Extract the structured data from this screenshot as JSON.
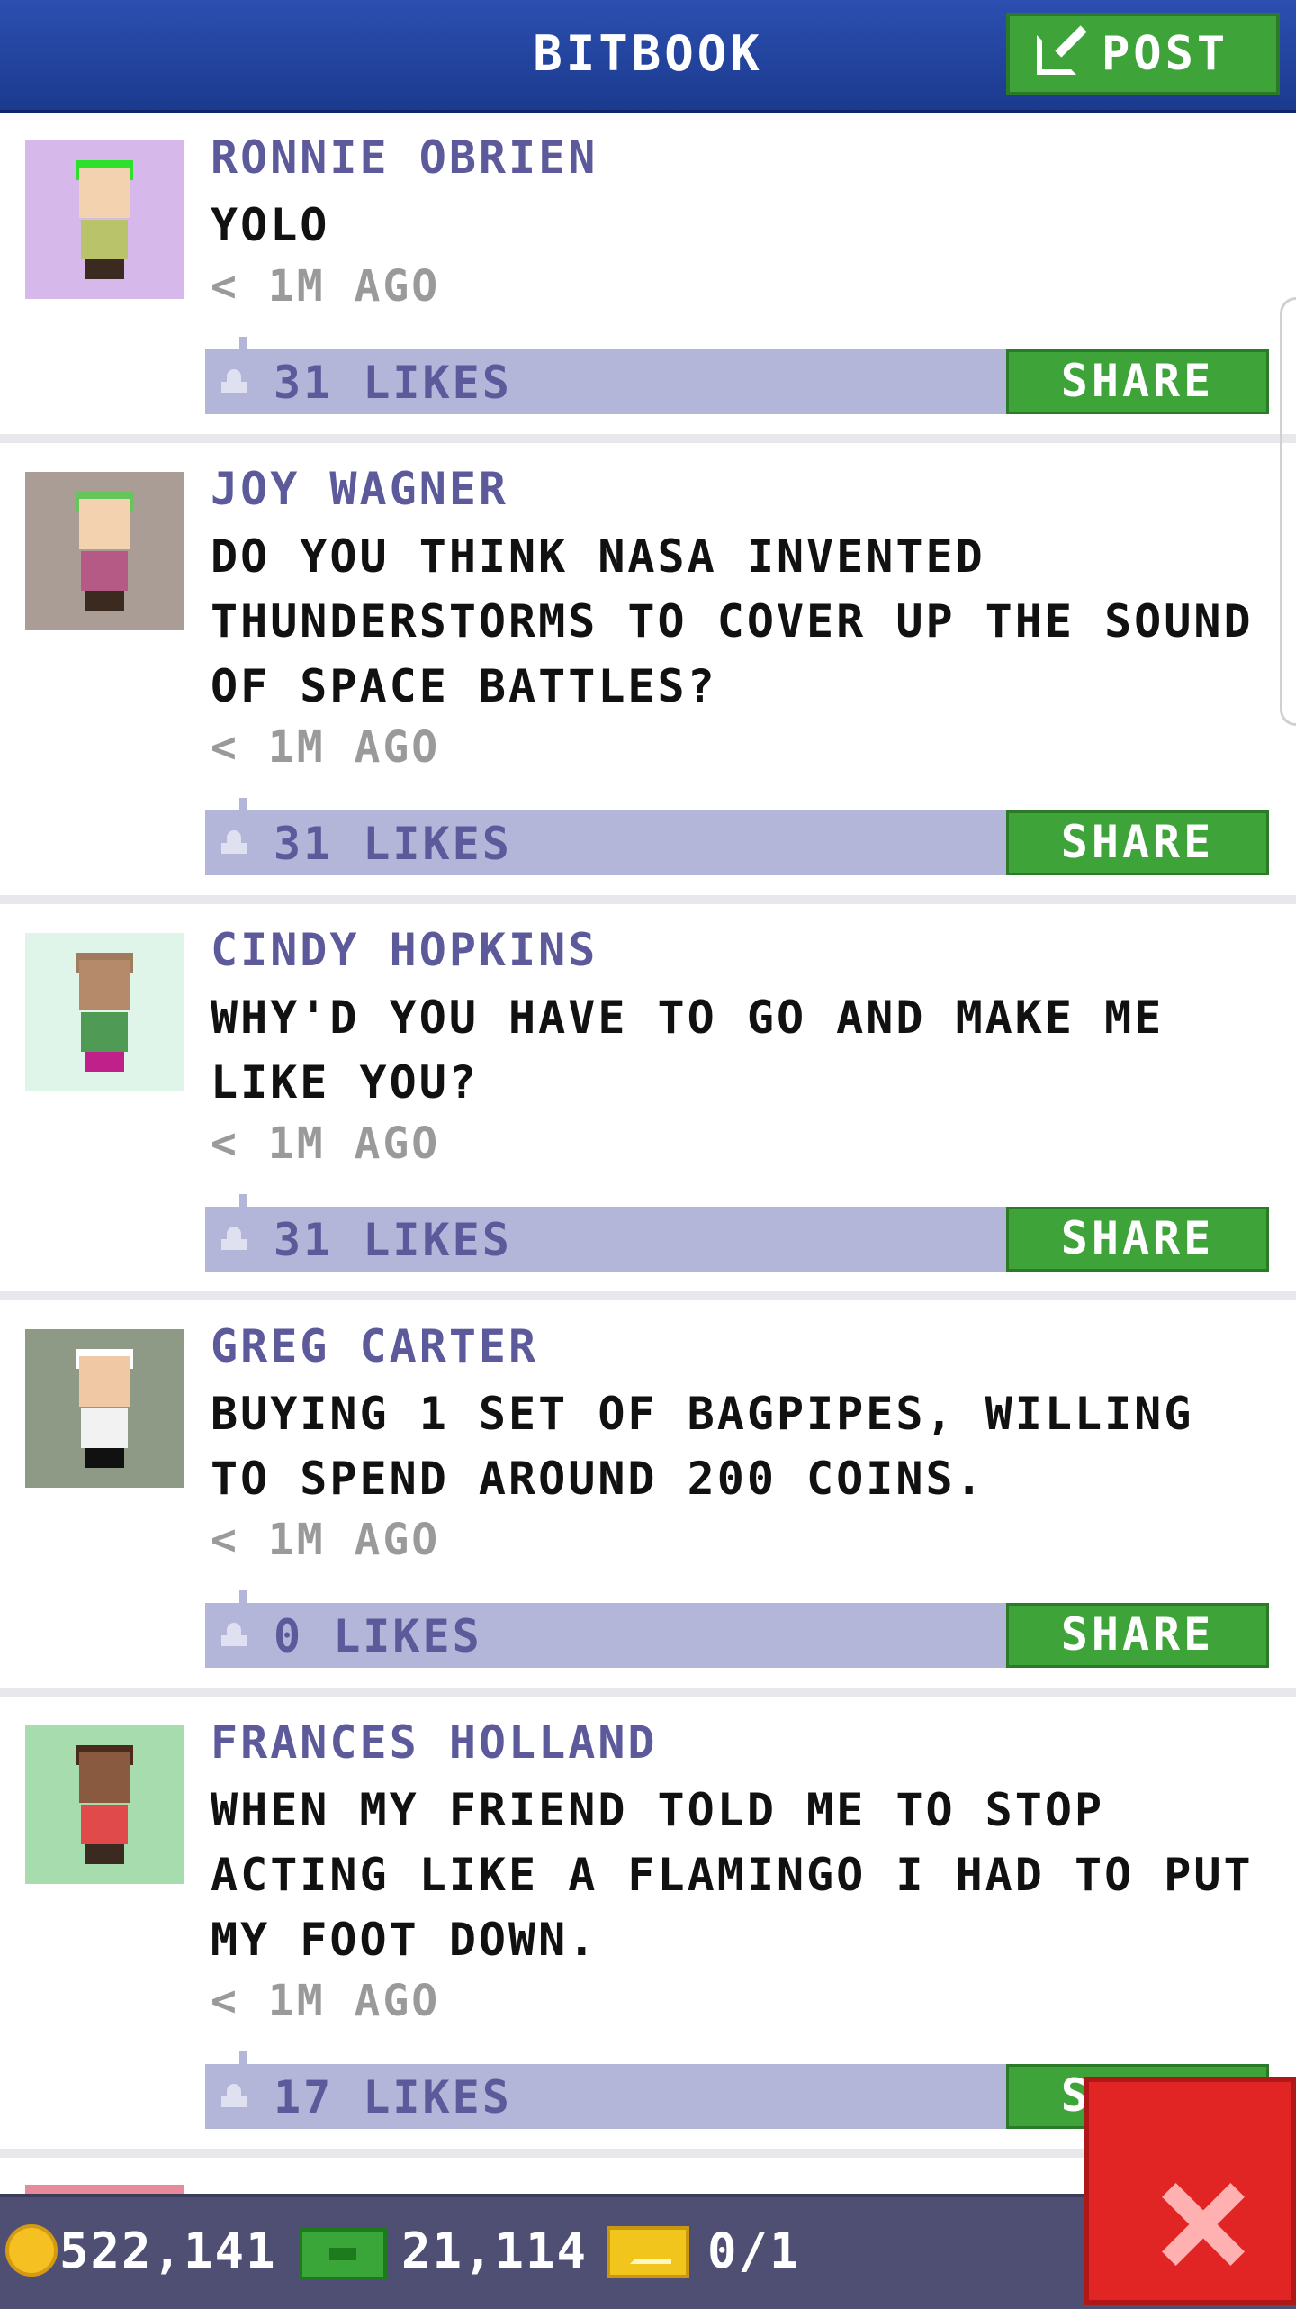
{
  "header": {
    "title": "BITBOOK",
    "post_label": "POST"
  },
  "posts": [
    {
      "name": "RONNIE OBRIEN",
      "message": "YOLO",
      "time": "< 1M AGO",
      "likes": "31 LIKES",
      "share": "SHARE"
    },
    {
      "name": "JOY WAGNER",
      "message": "DO YOU THINK NASA INVENTED THUNDERSTORMS TO COVER UP THE SOUND OF SPACE BATTLES?",
      "time": "< 1M AGO",
      "likes": "31 LIKES",
      "share": "SHARE"
    },
    {
      "name": "CINDY HOPKINS",
      "message": "WHY'D YOU HAVE TO GO AND MAKE ME LIKE YOU?",
      "time": "< 1M AGO",
      "likes": "31 LIKES",
      "share": "SHARE"
    },
    {
      "name": "GREG CARTER",
      "message": "BUYING 1 SET OF BAGPIPES, WILLING TO SPEND AROUND 200 COINS.",
      "time": "< 1M AGO",
      "likes": "0 LIKES",
      "share": "SHARE"
    },
    {
      "name": "FRANCES HOLLAND",
      "message": "WHEN MY FRIEND TOLD ME TO STOP ACTING LIKE A FLAMINGO I HAD TO PUT MY FOOT DOWN.",
      "time": "< 1M AGO",
      "likes": "17 LIKES",
      "share": "SHARE"
    }
  ],
  "status_bar": {
    "coins": "522,141",
    "bux": "21,114",
    "tickets": "0/1"
  },
  "icons": {
    "post": "edit-icon",
    "like": "thumbs-up-icon",
    "coin": "coin-icon",
    "bux": "bux-icon",
    "ticket": "ticket-icon",
    "close": "close-icon"
  },
  "colors": {
    "header_blue": "#1f3f95",
    "accent_green": "#3ea43a",
    "likes_bar": "#b3b5d9",
    "name_purple": "#5c5a9a",
    "status_bar": "#4f4f73",
    "close_red": "#e12525"
  }
}
